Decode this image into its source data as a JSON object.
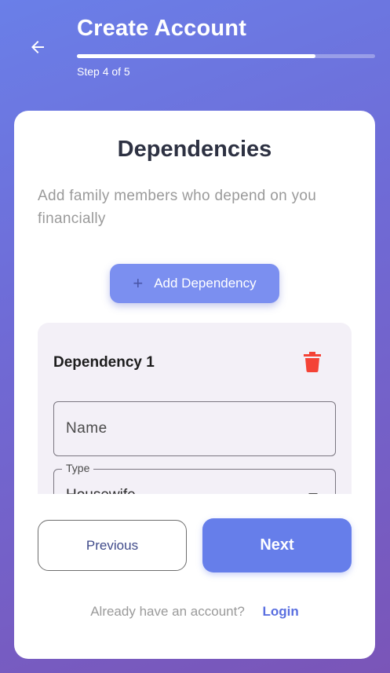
{
  "header": {
    "title": "Create Account",
    "step_label": "Step 4 of 5",
    "progress_fraction": 0.8,
    "back_icon": "arrow-left-icon"
  },
  "card": {
    "title": "Dependencies",
    "subtitle": "Add family members who depend on you financially",
    "add_button_label": "Add Dependency",
    "add_icon": "plus-icon"
  },
  "dependencies": [
    {
      "title": "Dependency 1",
      "delete_icon": "trash-icon",
      "name_placeholder": "Name",
      "type_label": "Type",
      "type_value": "Housewife"
    }
  ],
  "footer": {
    "previous_label": "Previous",
    "next_label": "Next",
    "login_question": "Already have an account?",
    "login_link": "Login"
  },
  "colors": {
    "accent": "#667eea",
    "add_button": "#7b8ff0",
    "delete": "#f44336",
    "background_start": "#6a7fe8",
    "background_end": "#7a55b8"
  }
}
